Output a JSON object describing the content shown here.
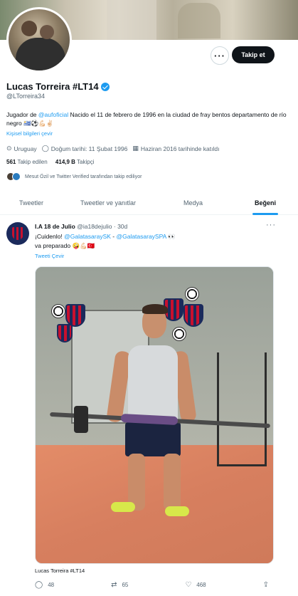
{
  "profile": {
    "name": "Lucas Torreira #LT14",
    "handle": "@LTorreira34",
    "follow_label": "Takip et",
    "more_label": "···",
    "bio_prefix": "Jugador de ",
    "bio_link": "@aufoficial",
    "bio_rest": " Nacido el 11 de febrero de 1996 en la ciudad de fray bentos departamento de río negro 🇺🇾⚽💪🏻✌🏻",
    "translate_bio": "Kişisel bilgileri çevir",
    "location": "Uruguay",
    "birthday": "Doğum tarihi: 11 Şubat 1996",
    "joined": "Haziran 2016 tarihinde katıldı",
    "following_count": "561",
    "following_label": "Takip edilen",
    "followers_count": "414,9 B",
    "followers_label": "Takipçi",
    "followed_by": "Mesut Özil ve Twitter Verified tarafından takip ediliyor"
  },
  "tabs": [
    {
      "label": "Tweetler"
    },
    {
      "label": "Tweetler ve yanıtlar"
    },
    {
      "label": "Medya"
    },
    {
      "label": "Beğeni"
    }
  ],
  "tweet": {
    "author": "I.A 18 de Julio",
    "handle": "@ia18dejulio",
    "time": "· 30d",
    "line1_prefix": "¡Cuidenlo! ",
    "mention1": "@GalatasaraySK",
    "dash": " - ",
    "mention2": "@GalatasaraySPA",
    "line1_emoji": " 👀",
    "line2": "va preparado 🤪💪🏻🇹🇷",
    "translate": "Tweeti Çevir",
    "photo_caption": "Lucas Torreira #LT14",
    "replies": "48",
    "retweets": "65",
    "likes": "468"
  },
  "icons": {
    "location": "location-pin-icon",
    "birthday": "balloon-icon",
    "calendar": "calendar-icon",
    "reply": "reply-icon",
    "retweet": "retweet-icon",
    "like": "heart-icon",
    "share": "share-icon"
  },
  "colors": {
    "accent": "#1d9bf0",
    "text": "#0f1419",
    "muted": "#536471"
  }
}
